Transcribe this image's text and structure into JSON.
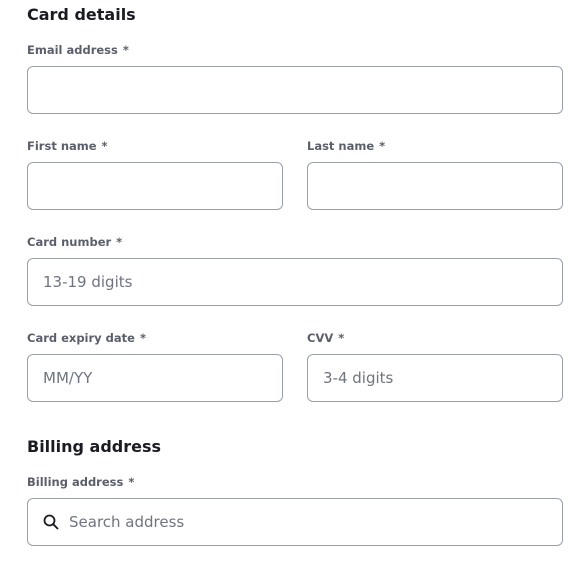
{
  "card_details": {
    "title": "Card details",
    "required_marker": "*",
    "email": {
      "label": "Email address",
      "value": "",
      "placeholder": ""
    },
    "first_name": {
      "label": "First name",
      "value": "",
      "placeholder": ""
    },
    "last_name": {
      "label": "Last name",
      "value": "",
      "placeholder": ""
    },
    "card_number": {
      "label": "Card number",
      "value": "",
      "placeholder": "13-19 digits"
    },
    "expiry": {
      "label": "Card expiry date",
      "value": "",
      "placeholder": "MM/YY"
    },
    "cvv": {
      "label": "CVV",
      "value": "",
      "placeholder": "3-4 digits"
    }
  },
  "billing": {
    "title": "Billing address",
    "address": {
      "label": "Billing address",
      "value": "",
      "placeholder": "Search address",
      "icon": "search-icon"
    }
  },
  "colors": {
    "title_text": "#1a1c22",
    "label_text": "#5a5f6b",
    "field_border": "#9aa0ab",
    "placeholder_text": "#6f7480"
  }
}
